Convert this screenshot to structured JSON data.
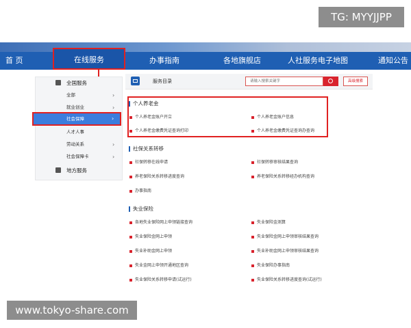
{
  "overlay": {
    "tg_label": "TG: MYYJJPP",
    "watermark": "www.tokyo-share.com"
  },
  "nav": {
    "items": [
      "首 页",
      "在线服务",
      "办事指南",
      "各地旗舰店",
      "人社服务电子地图",
      "通知公告"
    ],
    "active_index": 1
  },
  "sidebar": {
    "header": "全国服务",
    "items": [
      {
        "label": "全部",
        "arrow": "›"
      },
      {
        "label": "就业创业",
        "arrow": "›"
      },
      {
        "label": "社会保障",
        "arrow": "›"
      },
      {
        "label": "人才人事",
        "arrow": ""
      },
      {
        "label": "劳动关系",
        "arrow": "›"
      },
      {
        "label": "社会保障卡",
        "arrow": "›"
      }
    ],
    "footer": "地方服务",
    "active_index": 2
  },
  "main": {
    "dir_title": "服务目录",
    "search_placeholder": "请输入搜索关键字",
    "adv_search": "高级搜索",
    "sections": [
      {
        "title": "个人养老金",
        "links": [
          "个人养老金账户开立",
          "个人养老金账户信息",
          "个人养老金缴费凭证查询打印",
          "个人养老金缴费凭证查询办查询"
        ]
      },
      {
        "title": "社保关系转移",
        "links": [
          "社保转移在线申请",
          "社保转移审核结果查询",
          "养老保险关系转移进度查询",
          "养老保险关系转移经办机构查询",
          "办事指南"
        ]
      },
      {
        "title": "失业保险",
        "links": [
          "各地失业保险网上申领链接查询",
          "失业保险金测算",
          "失业保险金网上申领",
          "失业保险金网上申领审核结果查询",
          "失业补助金网上申领",
          "失业补助金网上申领审核结果查询",
          "失业金网上申领开通地区查询",
          "失业保险办事指南",
          "失业保险关系转移申请(试运行)",
          "失业保险关系转移进度查询(试运行)"
        ]
      }
    ]
  },
  "colors": {
    "nav_blue": "#1f5fb3",
    "highlight_red": "#e02020",
    "active_blue": "#3b7ddd",
    "bullet_red": "#d9232d"
  }
}
